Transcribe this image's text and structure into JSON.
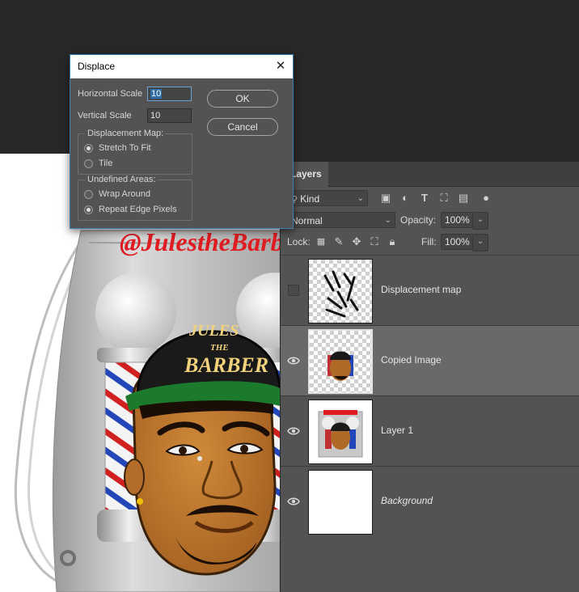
{
  "dialog": {
    "title": "Displace",
    "close_glyph": "✕",
    "horizontal_scale_label": "Horizontal Scale",
    "horizontal_scale_value": "10",
    "vertical_scale_label": "Vertical Scale",
    "vertical_scale_value": "10",
    "ok_label": "OK",
    "cancel_label": "Cancel",
    "displacement_map": {
      "legend": "Displacement Map:",
      "options": [
        "Stretch To Fit",
        "Tile"
      ],
      "selected": "Stretch To Fit"
    },
    "undefined_areas": {
      "legend": "Undefined Areas:",
      "options": [
        "Wrap Around",
        "Repeat Edge Pixels"
      ],
      "selected": "Repeat Edge Pixels"
    }
  },
  "layers_panel": {
    "tab_label": "Layers",
    "filter_kind": "Kind",
    "blend_mode": "Normal",
    "opacity_label": "Opacity:",
    "opacity_value": "100%",
    "lock_label": "Lock:",
    "fill_label": "Fill:",
    "fill_value": "100%",
    "layers": [
      {
        "name": "Displacement map",
        "visible": false,
        "selected": false
      },
      {
        "name": "Copied Image",
        "visible": true,
        "selected": true
      },
      {
        "name": "Layer 1",
        "visible": true,
        "selected": false
      },
      {
        "name": "Background",
        "visible": true,
        "selected": false
      }
    ]
  },
  "canvas": {
    "handle_text": "@JulestheBarber",
    "cap_text_line1": "JULES",
    "cap_text_line2": "THE",
    "cap_text_line3": "BARBER"
  },
  "colors": {
    "accent": "#3c7fb1",
    "panel": "#535353",
    "selected_row": "#696969",
    "workspace": "#282828",
    "handle_red": "#e01b22",
    "cap_gold": "#f2d27a"
  }
}
